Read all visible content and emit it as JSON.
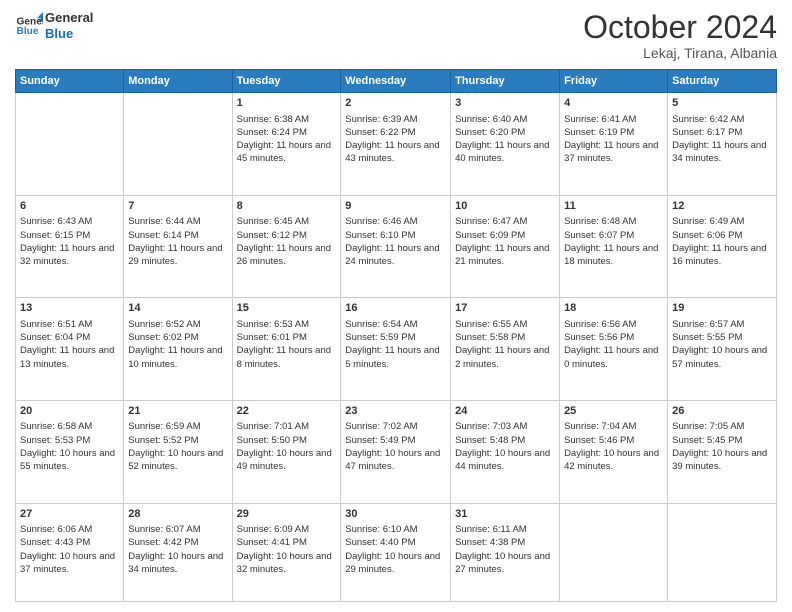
{
  "header": {
    "logo_line1": "General",
    "logo_line2": "Blue",
    "month": "October 2024",
    "location": "Lekaj, Tirana, Albania"
  },
  "weekdays": [
    "Sunday",
    "Monday",
    "Tuesday",
    "Wednesday",
    "Thursday",
    "Friday",
    "Saturday"
  ],
  "weeks": [
    [
      {
        "day": "",
        "sunrise": "",
        "sunset": "",
        "daylight": ""
      },
      {
        "day": "",
        "sunrise": "",
        "sunset": "",
        "daylight": ""
      },
      {
        "day": "1",
        "sunrise": "Sunrise: 6:38 AM",
        "sunset": "Sunset: 6:24 PM",
        "daylight": "Daylight: 11 hours and 45 minutes."
      },
      {
        "day": "2",
        "sunrise": "Sunrise: 6:39 AM",
        "sunset": "Sunset: 6:22 PM",
        "daylight": "Daylight: 11 hours and 43 minutes."
      },
      {
        "day": "3",
        "sunrise": "Sunrise: 6:40 AM",
        "sunset": "Sunset: 6:20 PM",
        "daylight": "Daylight: 11 hours and 40 minutes."
      },
      {
        "day": "4",
        "sunrise": "Sunrise: 6:41 AM",
        "sunset": "Sunset: 6:19 PM",
        "daylight": "Daylight: 11 hours and 37 minutes."
      },
      {
        "day": "5",
        "sunrise": "Sunrise: 6:42 AM",
        "sunset": "Sunset: 6:17 PM",
        "daylight": "Daylight: 11 hours and 34 minutes."
      }
    ],
    [
      {
        "day": "6",
        "sunrise": "Sunrise: 6:43 AM",
        "sunset": "Sunset: 6:15 PM",
        "daylight": "Daylight: 11 hours and 32 minutes."
      },
      {
        "day": "7",
        "sunrise": "Sunrise: 6:44 AM",
        "sunset": "Sunset: 6:14 PM",
        "daylight": "Daylight: 11 hours and 29 minutes."
      },
      {
        "day": "8",
        "sunrise": "Sunrise: 6:45 AM",
        "sunset": "Sunset: 6:12 PM",
        "daylight": "Daylight: 11 hours and 26 minutes."
      },
      {
        "day": "9",
        "sunrise": "Sunrise: 6:46 AM",
        "sunset": "Sunset: 6:10 PM",
        "daylight": "Daylight: 11 hours and 24 minutes."
      },
      {
        "day": "10",
        "sunrise": "Sunrise: 6:47 AM",
        "sunset": "Sunset: 6:09 PM",
        "daylight": "Daylight: 11 hours and 21 minutes."
      },
      {
        "day": "11",
        "sunrise": "Sunrise: 6:48 AM",
        "sunset": "Sunset: 6:07 PM",
        "daylight": "Daylight: 11 hours and 18 minutes."
      },
      {
        "day": "12",
        "sunrise": "Sunrise: 6:49 AM",
        "sunset": "Sunset: 6:06 PM",
        "daylight": "Daylight: 11 hours and 16 minutes."
      }
    ],
    [
      {
        "day": "13",
        "sunrise": "Sunrise: 6:51 AM",
        "sunset": "Sunset: 6:04 PM",
        "daylight": "Daylight: 11 hours and 13 minutes."
      },
      {
        "day": "14",
        "sunrise": "Sunrise: 6:52 AM",
        "sunset": "Sunset: 6:02 PM",
        "daylight": "Daylight: 11 hours and 10 minutes."
      },
      {
        "day": "15",
        "sunrise": "Sunrise: 6:53 AM",
        "sunset": "Sunset: 6:01 PM",
        "daylight": "Daylight: 11 hours and 8 minutes."
      },
      {
        "day": "16",
        "sunrise": "Sunrise: 6:54 AM",
        "sunset": "Sunset: 5:59 PM",
        "daylight": "Daylight: 11 hours and 5 minutes."
      },
      {
        "day": "17",
        "sunrise": "Sunrise: 6:55 AM",
        "sunset": "Sunset: 5:58 PM",
        "daylight": "Daylight: 11 hours and 2 minutes."
      },
      {
        "day": "18",
        "sunrise": "Sunrise: 6:56 AM",
        "sunset": "Sunset: 5:56 PM",
        "daylight": "Daylight: 11 hours and 0 minutes."
      },
      {
        "day": "19",
        "sunrise": "Sunrise: 6:57 AM",
        "sunset": "Sunset: 5:55 PM",
        "daylight": "Daylight: 10 hours and 57 minutes."
      }
    ],
    [
      {
        "day": "20",
        "sunrise": "Sunrise: 6:58 AM",
        "sunset": "Sunset: 5:53 PM",
        "daylight": "Daylight: 10 hours and 55 minutes."
      },
      {
        "day": "21",
        "sunrise": "Sunrise: 6:59 AM",
        "sunset": "Sunset: 5:52 PM",
        "daylight": "Daylight: 10 hours and 52 minutes."
      },
      {
        "day": "22",
        "sunrise": "Sunrise: 7:01 AM",
        "sunset": "Sunset: 5:50 PM",
        "daylight": "Daylight: 10 hours and 49 minutes."
      },
      {
        "day": "23",
        "sunrise": "Sunrise: 7:02 AM",
        "sunset": "Sunset: 5:49 PM",
        "daylight": "Daylight: 10 hours and 47 minutes."
      },
      {
        "day": "24",
        "sunrise": "Sunrise: 7:03 AM",
        "sunset": "Sunset: 5:48 PM",
        "daylight": "Daylight: 10 hours and 44 minutes."
      },
      {
        "day": "25",
        "sunrise": "Sunrise: 7:04 AM",
        "sunset": "Sunset: 5:46 PM",
        "daylight": "Daylight: 10 hours and 42 minutes."
      },
      {
        "day": "26",
        "sunrise": "Sunrise: 7:05 AM",
        "sunset": "Sunset: 5:45 PM",
        "daylight": "Daylight: 10 hours and 39 minutes."
      }
    ],
    [
      {
        "day": "27",
        "sunrise": "Sunrise: 6:06 AM",
        "sunset": "Sunset: 4:43 PM",
        "daylight": "Daylight: 10 hours and 37 minutes."
      },
      {
        "day": "28",
        "sunrise": "Sunrise: 6:07 AM",
        "sunset": "Sunset: 4:42 PM",
        "daylight": "Daylight: 10 hours and 34 minutes."
      },
      {
        "day": "29",
        "sunrise": "Sunrise: 6:09 AM",
        "sunset": "Sunset: 4:41 PM",
        "daylight": "Daylight: 10 hours and 32 minutes."
      },
      {
        "day": "30",
        "sunrise": "Sunrise: 6:10 AM",
        "sunset": "Sunset: 4:40 PM",
        "daylight": "Daylight: 10 hours and 29 minutes."
      },
      {
        "day": "31",
        "sunrise": "Sunrise: 6:11 AM",
        "sunset": "Sunset: 4:38 PM",
        "daylight": "Daylight: 10 hours and 27 minutes."
      },
      {
        "day": "",
        "sunrise": "",
        "sunset": "",
        "daylight": ""
      },
      {
        "day": "",
        "sunrise": "",
        "sunset": "",
        "daylight": ""
      }
    ]
  ]
}
